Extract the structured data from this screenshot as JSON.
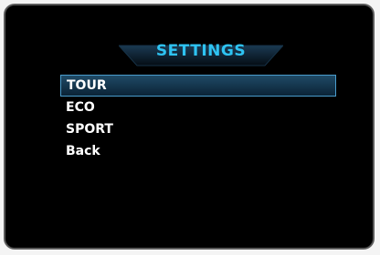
{
  "screen": {
    "title": "SETTINGS",
    "accent_color": "#2ec3f2",
    "highlight_border_color": "#4a9ccc"
  },
  "menu": {
    "items": [
      {
        "label": "TOUR",
        "selected": true
      },
      {
        "label": "ECO",
        "selected": false
      },
      {
        "label": "SPORT",
        "selected": false
      },
      {
        "label": "Back",
        "selected": false
      }
    ]
  }
}
